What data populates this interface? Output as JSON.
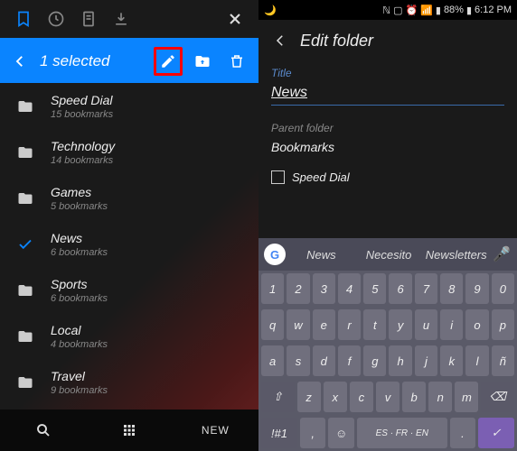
{
  "left": {
    "selection_text": "1 selected",
    "folders": [
      {
        "name": "Speed Dial",
        "sub": "15 bookmarks",
        "selected": false
      },
      {
        "name": "Technology",
        "sub": "14 bookmarks",
        "selected": false
      },
      {
        "name": "Games",
        "sub": "5 bookmarks",
        "selected": false
      },
      {
        "name": "News",
        "sub": "6 bookmarks",
        "selected": true
      },
      {
        "name": "Sports",
        "sub": "6 bookmarks",
        "selected": false
      },
      {
        "name": "Local",
        "sub": "4 bookmarks",
        "selected": false
      },
      {
        "name": "Travel",
        "sub": "9 bookmarks",
        "selected": false
      }
    ],
    "new_label": "NEW"
  },
  "right": {
    "status": {
      "battery": "88%",
      "time": "6:12 PM"
    },
    "header": "Edit folder",
    "title_label": "Title",
    "title_value": "News",
    "parent_label": "Parent folder",
    "parent_value": "Bookmarks",
    "checkbox_label": "Speed Dial",
    "suggestions": [
      "News",
      "Necesito",
      "Newsletters"
    ],
    "keyboard": {
      "row1": [
        "1",
        "2",
        "3",
        "4",
        "5",
        "6",
        "7",
        "8",
        "9",
        "0"
      ],
      "row2": [
        "q",
        "w",
        "e",
        "r",
        "t",
        "y",
        "u",
        "i",
        "o",
        "p"
      ],
      "row3": [
        "a",
        "s",
        "d",
        "f",
        "g",
        "h",
        "j",
        "k",
        "l",
        "ñ"
      ],
      "row4": [
        "z",
        "x",
        "c",
        "v",
        "b",
        "n",
        "m"
      ],
      "space": "ES · FR · EN",
      "sym": "!#1"
    }
  }
}
